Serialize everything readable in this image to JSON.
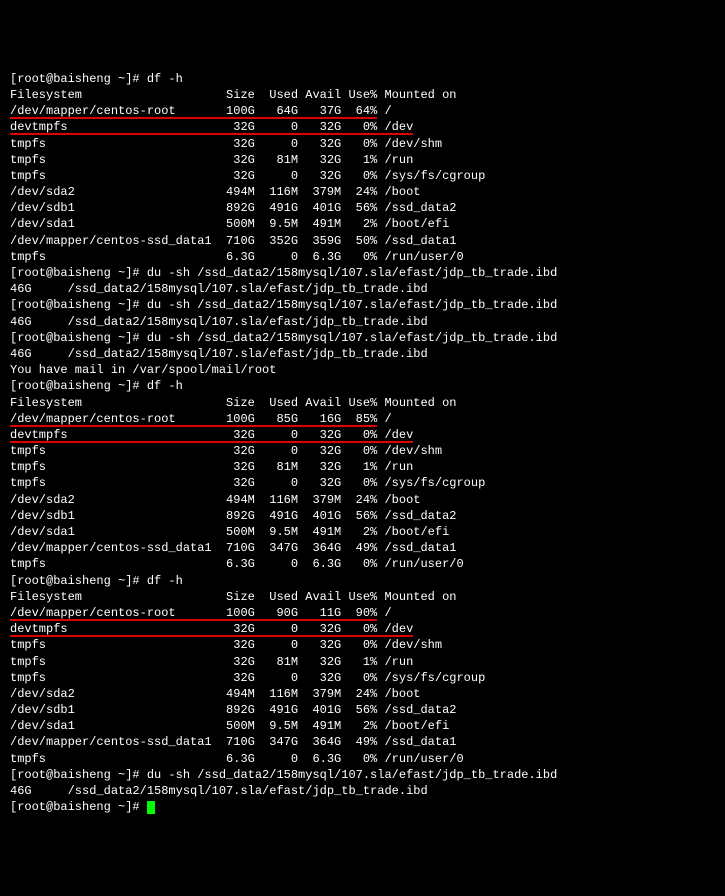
{
  "prompts": {
    "p1": "[root@baisheng ~]# ",
    "p2": "[root@baisheng ~]#",
    "p3": "[root@baisheng ~]# "
  },
  "commands": {
    "df_h": "df -h",
    "du_sh": "du -sh /ssd_data2/158mysql/107.sla/efast/jdp_tb_trade.ibd"
  },
  "df_header": {
    "fs": "Filesystem",
    "size": "Size",
    "used": "Used",
    "avail": "Avail",
    "usep": "Use%",
    "mount": "Mounted on"
  },
  "df1": {
    "rows": [
      {
        "fs": "/dev/mapper/centos-root",
        "size": "100G",
        "used": "64G",
        "avail": "37G",
        "usep": "64%",
        "mount": "/"
      },
      {
        "fs": "devtmpfs",
        "size": "32G",
        "used": "0",
        "avail": "32G",
        "usep": "0%",
        "mount": "/dev"
      },
      {
        "fs": "tmpfs",
        "size": "32G",
        "used": "0",
        "avail": "32G",
        "usep": "0%",
        "mount": "/dev/shm"
      },
      {
        "fs": "tmpfs",
        "size": "32G",
        "used": "81M",
        "avail": "32G",
        "usep": "1%",
        "mount": "/run"
      },
      {
        "fs": "tmpfs",
        "size": "32G",
        "used": "0",
        "avail": "32G",
        "usep": "0%",
        "mount": "/sys/fs/cgroup"
      },
      {
        "fs": "/dev/sda2",
        "size": "494M",
        "used": "116M",
        "avail": "379M",
        "usep": "24%",
        "mount": "/boot"
      },
      {
        "fs": "/dev/sdb1",
        "size": "892G",
        "used": "491G",
        "avail": "401G",
        "usep": "56%",
        "mount": "/ssd_data2"
      },
      {
        "fs": "/dev/sda1",
        "size": "500M",
        "used": "9.5M",
        "avail": "491M",
        "usep": "2%",
        "mount": "/boot/efi"
      },
      {
        "fs": "/dev/mapper/centos-ssd_data1",
        "size": "710G",
        "used": "352G",
        "avail": "359G",
        "usep": "50%",
        "mount": "/ssd_data1"
      },
      {
        "fs": "tmpfs",
        "size": "6.3G",
        "used": "0",
        "avail": "6.3G",
        "usep": "0%",
        "mount": "/run/user/0"
      }
    ]
  },
  "du1": {
    "size": "46G",
    "path": "/ssd_data2/158mysql/107.sla/efast/jdp_tb_trade.ibd"
  },
  "du2": {
    "size": "46G",
    "path": "/ssd_data2/158mysql/107.sla/efast/jdp_tb_trade.ibd"
  },
  "du3": {
    "size": "46G",
    "path": "/ssd_data2/158mysql/107.sla/efast/jdp_tb_trade.ibd"
  },
  "mail_notice": "You have mail in /var/spool/mail/root",
  "df2": {
    "rows": [
      {
        "fs": "/dev/mapper/centos-root",
        "size": "100G",
        "used": "85G",
        "avail": "16G",
        "usep": "85%",
        "mount": "/"
      },
      {
        "fs": "devtmpfs",
        "size": "32G",
        "used": "0",
        "avail": "32G",
        "usep": "0%",
        "mount": "/dev"
      },
      {
        "fs": "tmpfs",
        "size": "32G",
        "used": "0",
        "avail": "32G",
        "usep": "0%",
        "mount": "/dev/shm"
      },
      {
        "fs": "tmpfs",
        "size": "32G",
        "used": "81M",
        "avail": "32G",
        "usep": "1%",
        "mount": "/run"
      },
      {
        "fs": "tmpfs",
        "size": "32G",
        "used": "0",
        "avail": "32G",
        "usep": "0%",
        "mount": "/sys/fs/cgroup"
      },
      {
        "fs": "/dev/sda2",
        "size": "494M",
        "used": "116M",
        "avail": "379M",
        "usep": "24%",
        "mount": "/boot"
      },
      {
        "fs": "/dev/sdb1",
        "size": "892G",
        "used": "491G",
        "avail": "401G",
        "usep": "56%",
        "mount": "/ssd_data2"
      },
      {
        "fs": "/dev/sda1",
        "size": "500M",
        "used": "9.5M",
        "avail": "491M",
        "usep": "2%",
        "mount": "/boot/efi"
      },
      {
        "fs": "/dev/mapper/centos-ssd_data1",
        "size": "710G",
        "used": "347G",
        "avail": "364G",
        "usep": "49%",
        "mount": "/ssd_data1"
      },
      {
        "fs": "tmpfs",
        "size": "6.3G",
        "used": "0",
        "avail": "6.3G",
        "usep": "0%",
        "mount": "/run/user/0"
      }
    ]
  },
  "df3": {
    "rows": [
      {
        "fs": "/dev/mapper/centos-root",
        "size": "100G",
        "used": "90G",
        "avail": "11G",
        "usep": "90%",
        "mount": "/"
      },
      {
        "fs": "devtmpfs",
        "size": "32G",
        "used": "0",
        "avail": "32G",
        "usep": "0%",
        "mount": "/dev"
      },
      {
        "fs": "tmpfs",
        "size": "32G",
        "used": "0",
        "avail": "32G",
        "usep": "0%",
        "mount": "/dev/shm"
      },
      {
        "fs": "tmpfs",
        "size": "32G",
        "used": "81M",
        "avail": "32G",
        "usep": "1%",
        "mount": "/run"
      },
      {
        "fs": "tmpfs",
        "size": "32G",
        "used": "0",
        "avail": "32G",
        "usep": "0%",
        "mount": "/sys/fs/cgroup"
      },
      {
        "fs": "/dev/sda2",
        "size": "494M",
        "used": "116M",
        "avail": "379M",
        "usep": "24%",
        "mount": "/boot"
      },
      {
        "fs": "/dev/sdb1",
        "size": "892G",
        "used": "491G",
        "avail": "401G",
        "usep": "56%",
        "mount": "/ssd_data2"
      },
      {
        "fs": "/dev/sda1",
        "size": "500M",
        "used": "9.5M",
        "avail": "491M",
        "usep": "2%",
        "mount": "/boot/efi"
      },
      {
        "fs": "/dev/mapper/centos-ssd_data1",
        "size": "710G",
        "used": "347G",
        "avail": "364G",
        "usep": "49%",
        "mount": "/ssd_data1"
      },
      {
        "fs": "tmpfs",
        "size": "6.3G",
        "used": "0",
        "avail": "6.3G",
        "usep": "0%",
        "mount": "/run/user/0"
      }
    ]
  },
  "du4": {
    "size": "46G",
    "path": "/ssd_data2/158mysql/107.sla/efast/jdp_tb_trade.ibd"
  }
}
